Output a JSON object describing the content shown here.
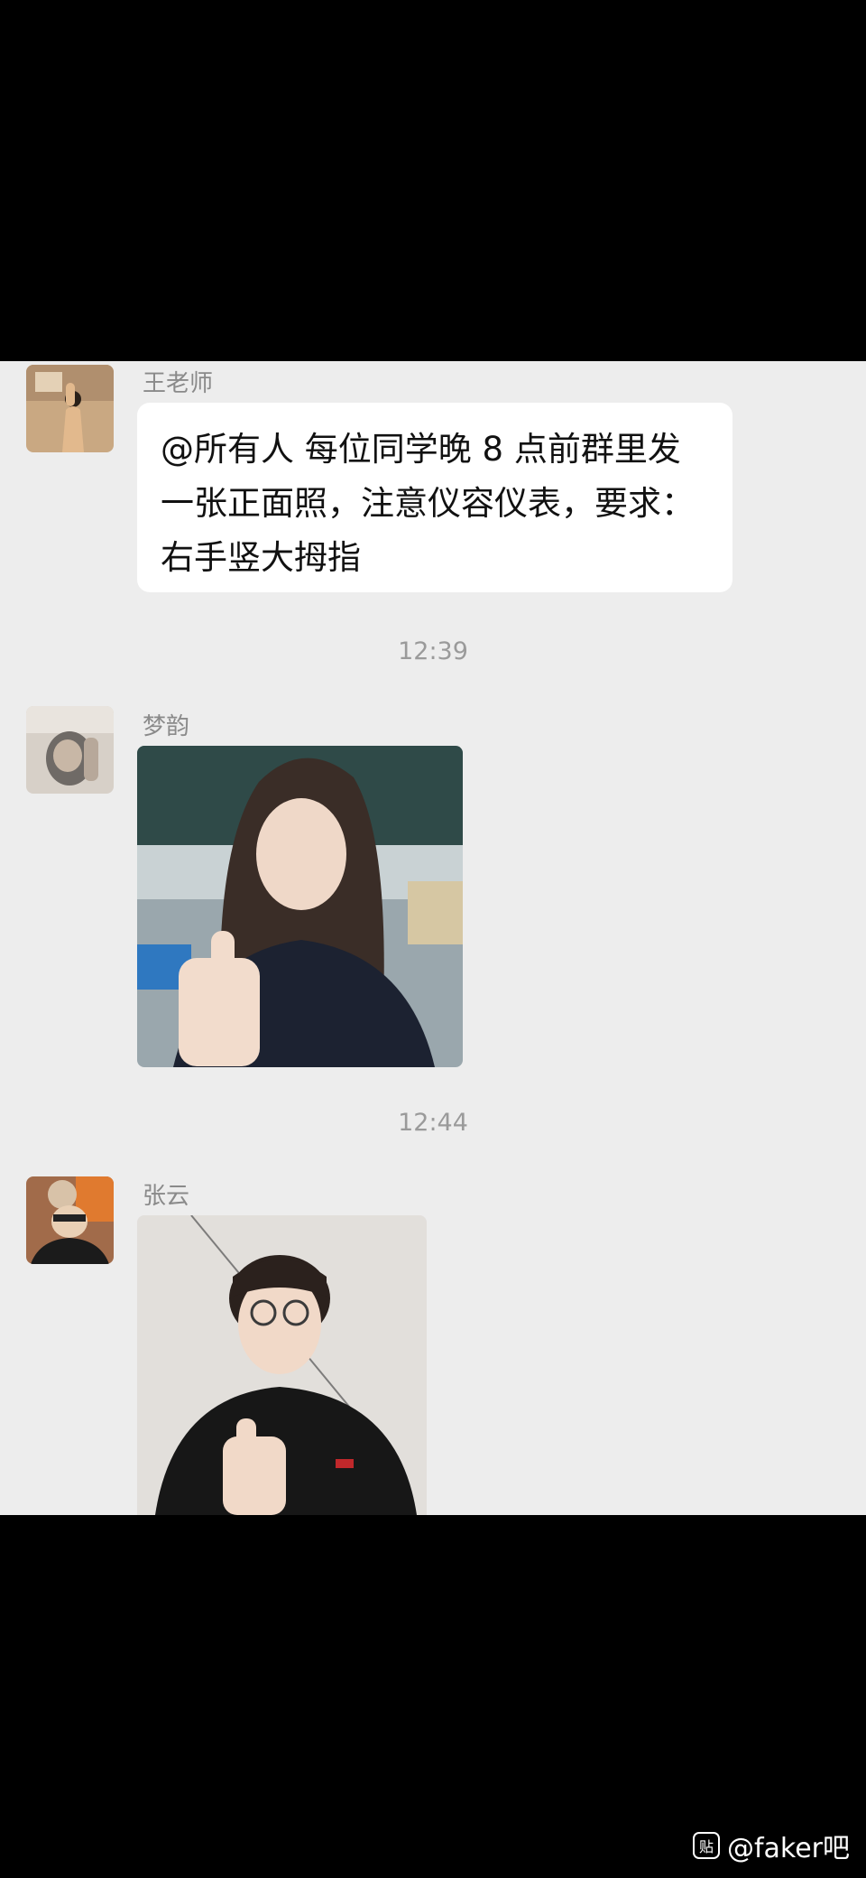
{
  "messages": [
    {
      "sender": "王老师",
      "text": "@所有人 每位同学晚 8 点前群里发\n一张正面照，注意仪容仪表，要求：\n右手竖大拇指"
    },
    {
      "sender": "梦韵"
    },
    {
      "sender": "张云"
    }
  ],
  "timestamps": [
    "12:39",
    "12:44"
  ],
  "watermark": {
    "icon": "贴",
    "text": "@faker吧"
  },
  "colors": {
    "chat_bg": "#ededed",
    "bubble_bg": "#ffffff",
    "frame_bg": "#000000"
  }
}
